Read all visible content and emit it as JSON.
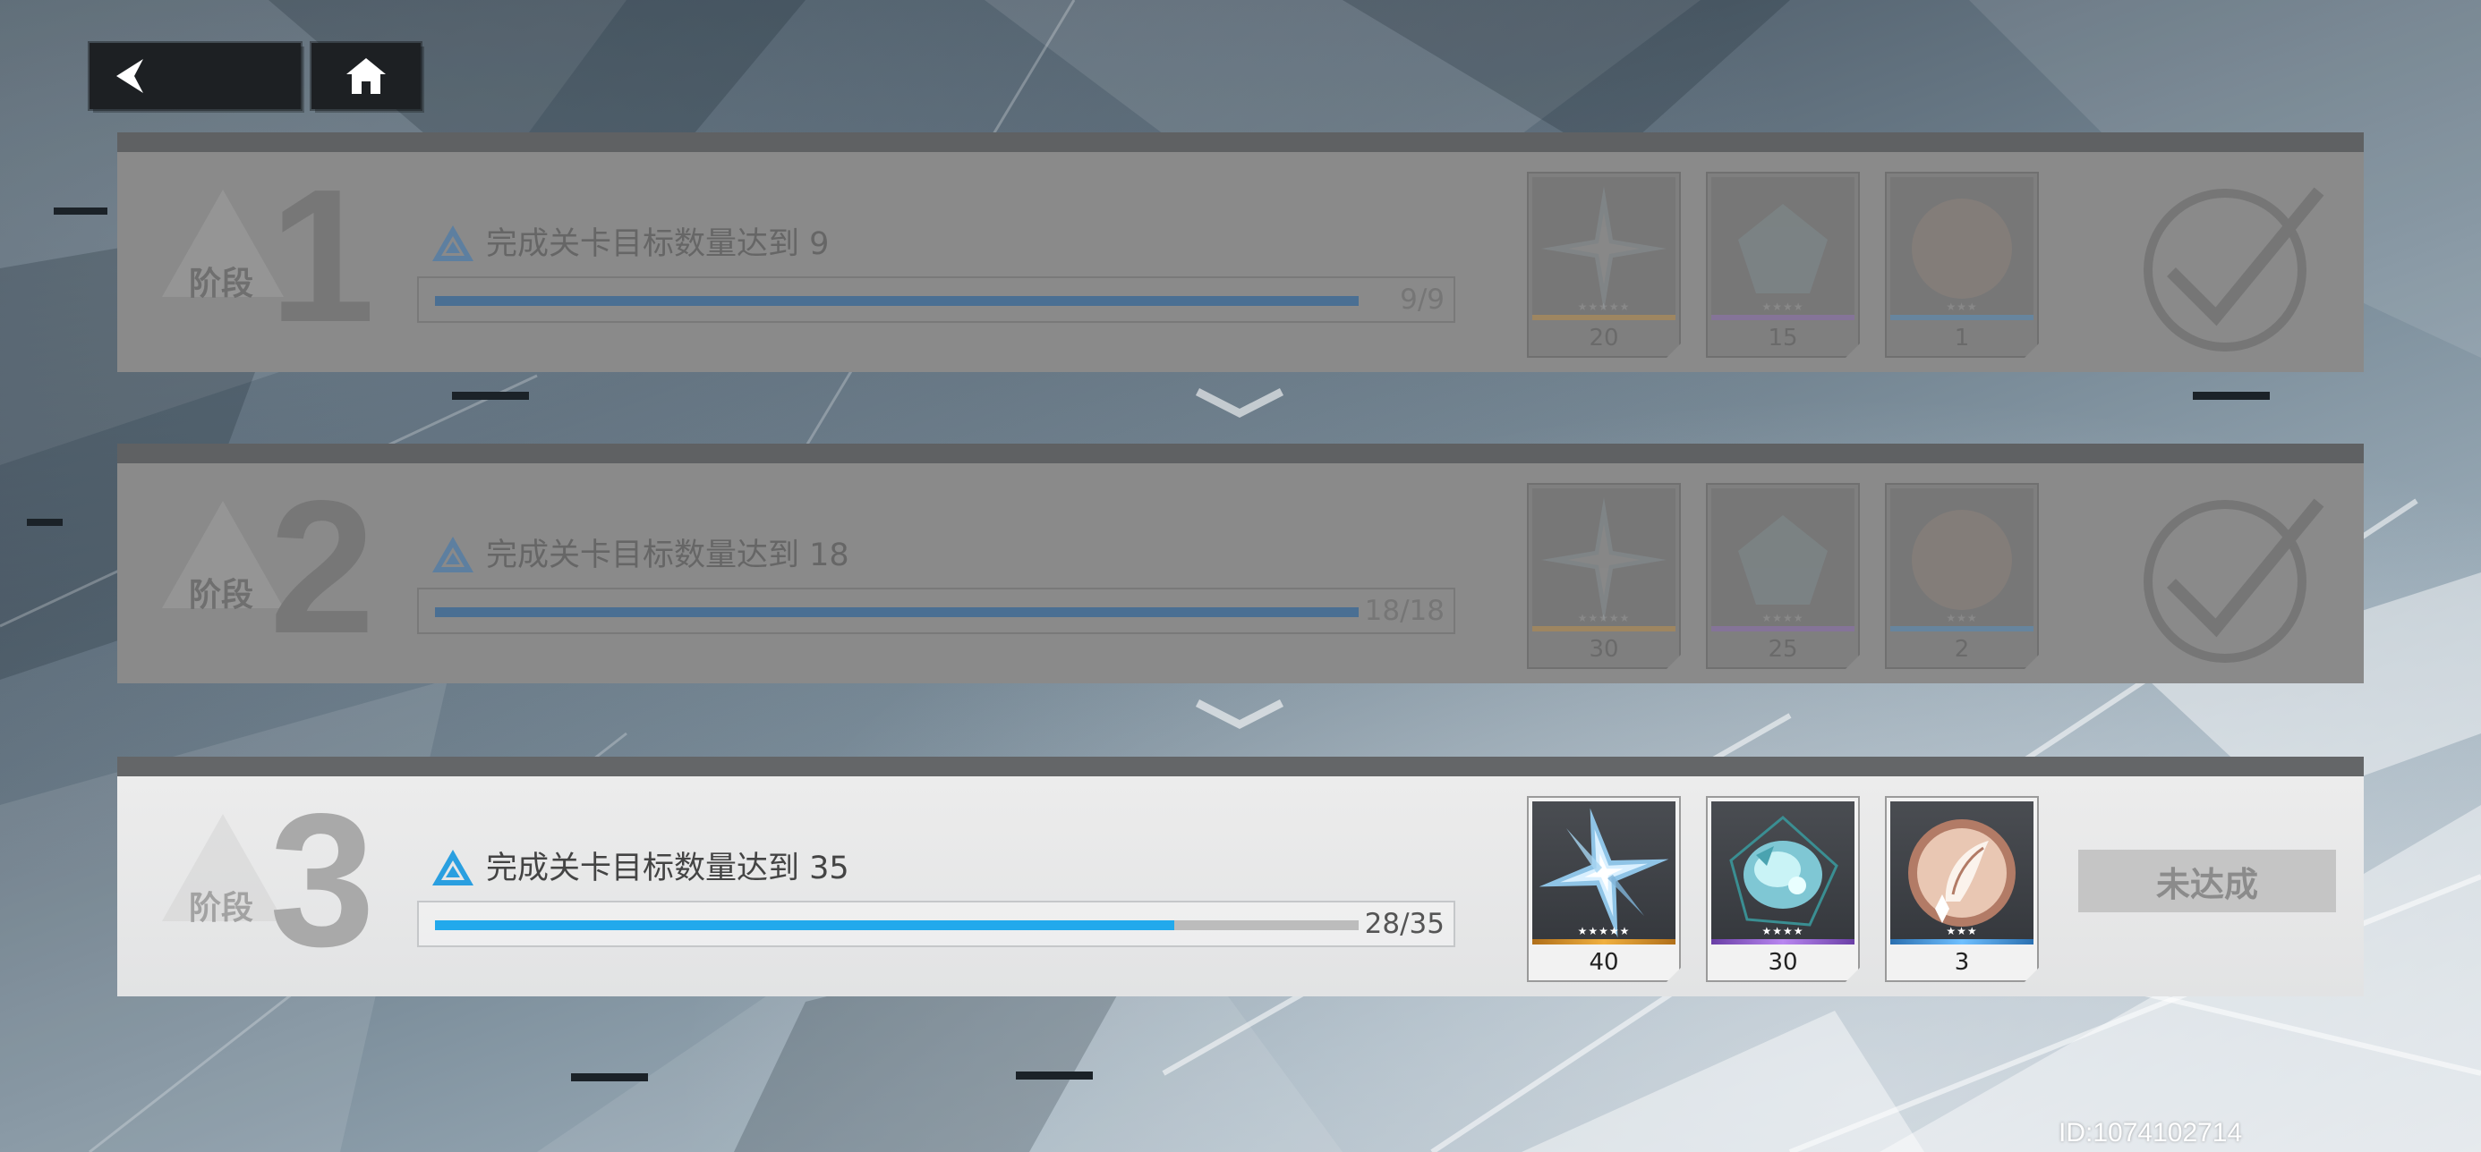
{
  "nav": {
    "back_icon": "chevron-left-icon",
    "home_icon": "home-icon"
  },
  "stages": [
    {
      "label": "阶段",
      "number": "1",
      "task": "完成关卡目标数量达到 9",
      "progress_text": "9/9",
      "progress_fraction": 1.0,
      "state": "completed",
      "rewards": [
        {
          "icon": "crystal-star-icon",
          "quantity": "20",
          "stars": "★★★★★"
        },
        {
          "icon": "glowing-ore-icon",
          "quantity": "15",
          "stars": "★★★★"
        },
        {
          "icon": "feather-emblem-icon",
          "quantity": "1",
          "stars": "★★★"
        }
      ]
    },
    {
      "label": "阶段",
      "number": "2",
      "task": "完成关卡目标数量达到 18",
      "progress_text": "18/18",
      "progress_fraction": 1.0,
      "state": "completed",
      "rewards": [
        {
          "icon": "crystal-star-icon",
          "quantity": "30",
          "stars": "★★★★★"
        },
        {
          "icon": "glowing-ore-icon",
          "quantity": "25",
          "stars": "★★★★"
        },
        {
          "icon": "feather-emblem-icon",
          "quantity": "2",
          "stars": "★★★"
        }
      ]
    },
    {
      "label": "阶段",
      "number": "3",
      "task": "完成关卡目标数量达到 35",
      "progress_text": "28/35",
      "progress_fraction": 0.8,
      "state": "in-progress",
      "status_label": "未达成",
      "rewards": [
        {
          "icon": "crystal-star-icon",
          "quantity": "40",
          "stars": "★★★★★"
        },
        {
          "icon": "glowing-ore-icon",
          "quantity": "30",
          "stars": "★★★★"
        },
        {
          "icon": "feather-emblem-icon",
          "quantity": "3",
          "stars": "★★★"
        }
      ]
    }
  ],
  "rarity_colors": {
    "five_star": "#e8a23a",
    "four_star": "#a070d8",
    "three_star": "#4aa0e8"
  },
  "accent_color": "#22a9ec",
  "player_id": "ID:1074102714"
}
